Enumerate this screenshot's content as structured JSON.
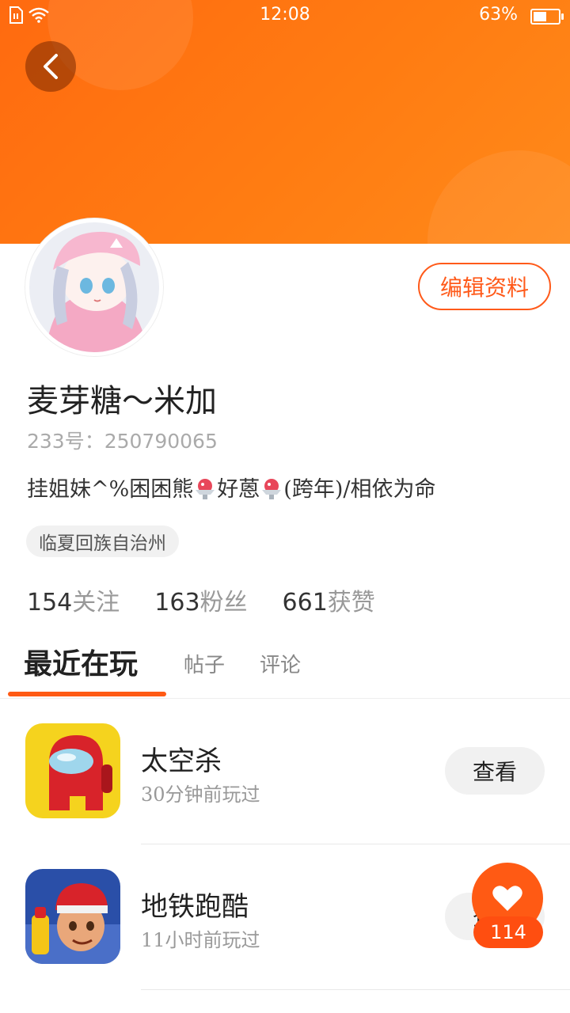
{
  "status_bar": {
    "time": "12:08",
    "battery_text": "63%",
    "battery_level": 0.63
  },
  "profile": {
    "name": "麦芽糖～米加",
    "id_label": "233号：",
    "id_value": "250790065",
    "bio_part1": "挂姐妹^%困困熊",
    "bio_part2": "好蒽",
    "bio_part3": "(跨年)/相依为命",
    "location": "临夏回族自治州",
    "edit_label": "编辑资料"
  },
  "stats": [
    {
      "num": "154",
      "label": "关注"
    },
    {
      "num": "163",
      "label": "粉丝"
    },
    {
      "num": "661",
      "label": "获赞"
    }
  ],
  "tabs": [
    {
      "label": "最近在玩"
    },
    {
      "label": "帖子"
    },
    {
      "label": "评论"
    }
  ],
  "games": [
    {
      "title": "太空杀",
      "subtitle": "30分钟前玩过",
      "button": "查看"
    },
    {
      "title": "地铁跑酷",
      "subtitle": "11小时前玩过",
      "button": "查看"
    }
  ],
  "like": {
    "count": "114"
  },
  "colors": {
    "accent": "#ff5a14",
    "header_start": "#ff6a10",
    "header_end": "#ff8a1a"
  }
}
